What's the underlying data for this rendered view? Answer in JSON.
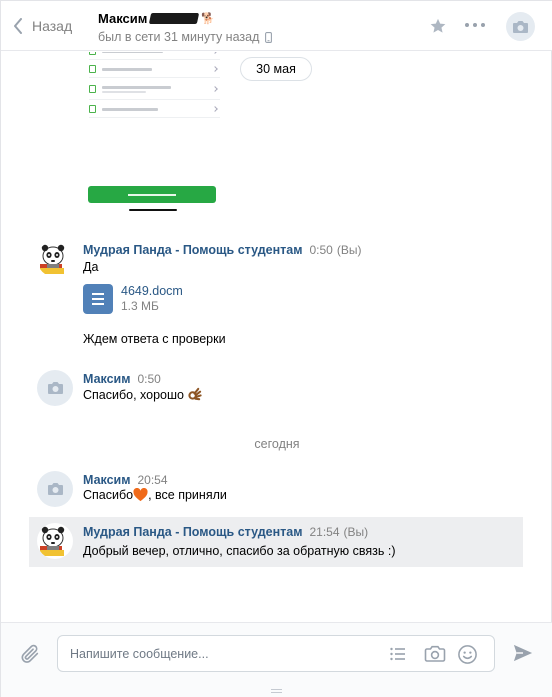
{
  "header": {
    "back_label": "Назад",
    "peer_name": "Максим",
    "peer_status": "был в сети 31 минуту назад",
    "icons": {
      "back": "chevron-left-icon",
      "star": "star-icon",
      "more": "more-dots-icon",
      "avatar": "camera-icon",
      "device": "mobile-phone-icon"
    }
  },
  "history": {
    "date_separator": "30 мая",
    "today_separator": "сегодня",
    "messages": [
      {
        "author": "Мудрая Панда - Помощь студентам",
        "time": "0:50",
        "suffix": "(Вы)",
        "text": "Да",
        "attachment": {
          "name": "4649.docm",
          "size": "1.3 МБ",
          "icon": "document-icon"
        },
        "text2": "Ждем ответа с проверки"
      },
      {
        "author": "Максим",
        "time": "0:50",
        "text": "Спасибо, хорошо",
        "emoji": "ok-hand-emoji"
      },
      {
        "author": "Максим",
        "time": "20:54",
        "text_before": "Спасибо",
        "emoji": "orange-heart-emoji",
        "text_after": ", все приняли"
      },
      {
        "author": "Мудрая Панда - Помощь студентам",
        "time": "21:54",
        "suffix": "(Вы)",
        "text": "Добрый вечер, отлично, спасибо за обратную связь :)"
      }
    ]
  },
  "composer": {
    "placeholder": "Напишите сообщение...",
    "value": "",
    "icons": {
      "attach": "paperclip-icon",
      "template": "list-icon",
      "photo": "camera-icon",
      "emoji": "smile-icon",
      "send": "send-icon"
    }
  },
  "colors": {
    "link": "#2a5885",
    "muted": "#828282",
    "doc_icon": "#5181b8",
    "selected_bg": "#edeef0",
    "heart": "#f06a1a",
    "button_green": "#27a844"
  }
}
